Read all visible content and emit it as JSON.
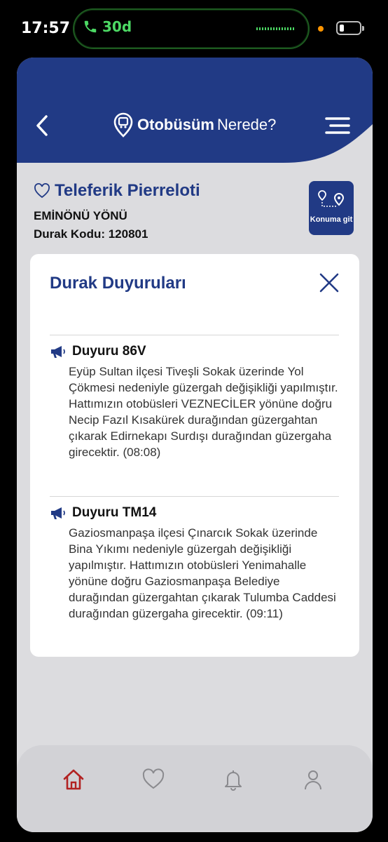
{
  "status_bar": {
    "time": "17:57",
    "call_duration": "30d",
    "accent": "#4cd964"
  },
  "header": {
    "logo_bold": "Otobüsüm",
    "logo_light": "Nerede?",
    "color": "#213a85"
  },
  "stop": {
    "name": "Teleferik Pierreloti",
    "direction": "EMİNÖNÜ YÖNÜ",
    "code_label": "Durak Kodu: 120801"
  },
  "location_button": {
    "label": "Konuma git"
  },
  "modal": {
    "title": "Durak Duyuruları",
    "announcements": [
      {
        "title": "Duyuru 86V",
        "body": "Eyüp Sultan ilçesi Tiveşli Sokak üzerinde Yol Çökmesi nedeniyle güzergah değişikliği yapılmıştır. Hattımızın otobüsleri VEZNECİLER yönüne doğru Necip Fazıl Kısakürek durağından güzergahtan çıkarak Edirnekapı Surdışı durağından güzergaha girecektir. (08:08)"
      },
      {
        "title": "Duyuru TM14",
        "body": "Gaziosmanpaşa ilçesi Çınarcık Sokak üzerinde Bina Yıkımı nedeniyle güzergah değişikliği yapılmıştır. Hattımızın otobüsleri Yenimahalle yönüne doğru Gaziosmanpaşa Belediye durağından güzergahtan çıkarak Tulumba Caddesi durağından güzergaha girecektir. (09:11)"
      }
    ]
  },
  "tabbar": {
    "items": [
      {
        "icon": "home-icon",
        "active": true,
        "color": "#b22222"
      },
      {
        "icon": "heart-icon",
        "active": false
      },
      {
        "icon": "bell-icon",
        "active": false
      },
      {
        "icon": "user-icon",
        "active": false
      }
    ]
  }
}
